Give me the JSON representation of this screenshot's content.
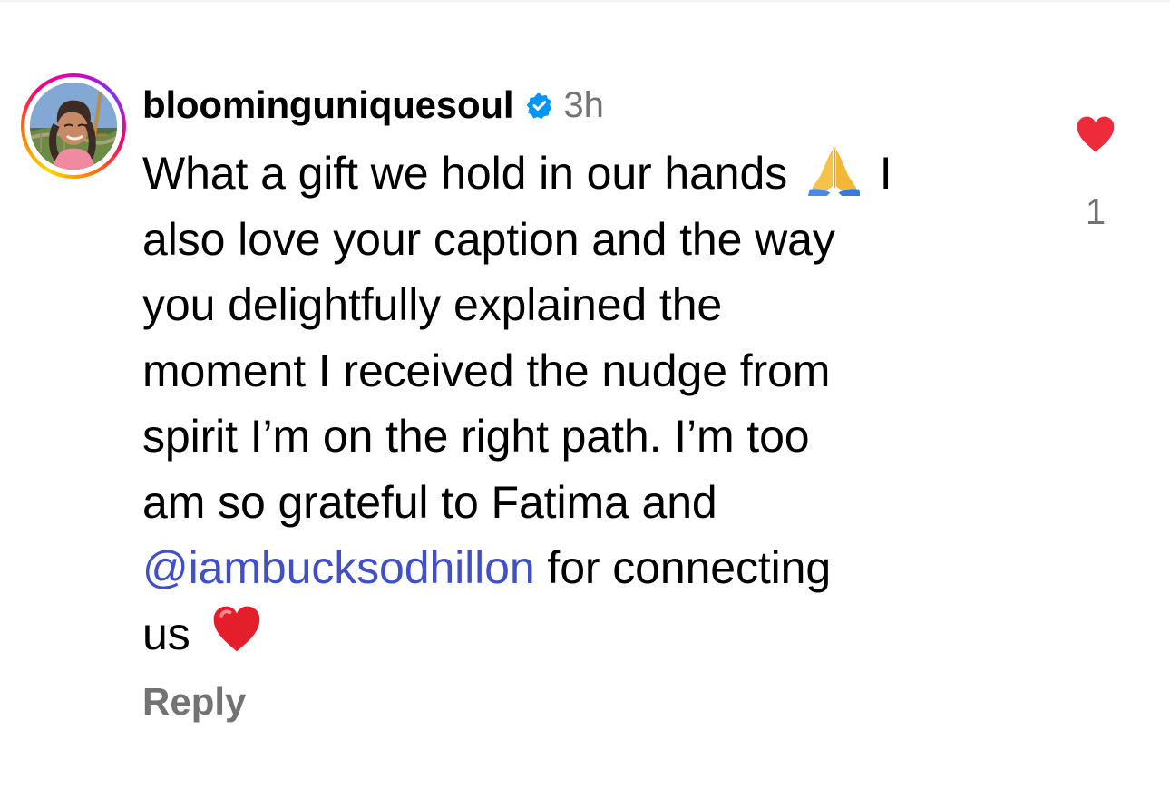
{
  "comment": {
    "username": "bloominguniquesoul",
    "timestamp": "3h",
    "verified_icon": "verified-badge-icon",
    "avatar_icon": "profile-photo",
    "text_lines": [
      "What a gift we hold in our hands",
      "I",
      "also love your caption and the way",
      "you delightfully explained the",
      "moment I received the nudge from",
      "spirit I’m on the right path.  I’m too",
      "am so grateful to Fatima and",
      "@iambucksodhillon",
      "for connecting",
      "us"
    ],
    "emoji": {
      "folded_hands": "folded-hands-emoji",
      "heart": "red-heart-emoji"
    },
    "reply_label": "Reply"
  },
  "like": {
    "icon": "heart-icon",
    "count": "1",
    "active_color": "#ed2b3b"
  },
  "colors": {
    "primary_text": "#000000",
    "secondary_text": "#737373",
    "mention": "#4150c8",
    "verified": "#0095f6"
  }
}
